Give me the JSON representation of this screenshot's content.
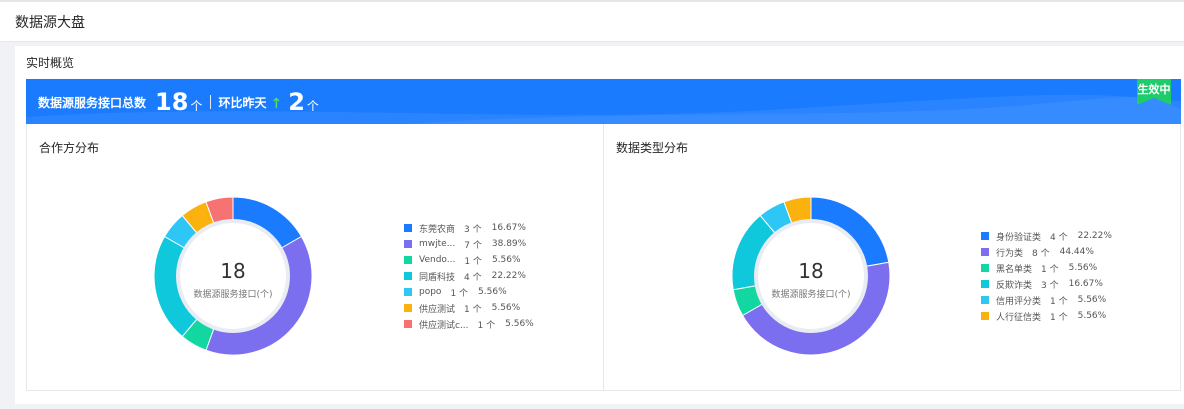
{
  "header": {
    "title": "数据源大盘"
  },
  "overview": {
    "title": "实时概览",
    "total_label": "数据源服务接口总数",
    "total_value": "18",
    "total_unit": "个",
    "compare_label": "环比昨天",
    "compare_arrow": "↑",
    "compare_value": "2",
    "compare_unit": "个",
    "status_badge": "生效中",
    "colors": {
      "banner": "#1a7bff",
      "badge": "#1fcc6b",
      "arrow": "#4cd96a"
    }
  },
  "partner_panel": {
    "title": "合作方分布",
    "center_value": "18",
    "center_caption": "数据源服务接口(个)",
    "items": [
      {
        "label": "东莞农商",
        "count": "3 个",
        "percent": "16.67%",
        "value": 3,
        "color": "#1a7bff"
      },
      {
        "label": "mwjte...",
        "count": "7 个",
        "percent": "38.89%",
        "value": 7,
        "color": "#7b6ff0"
      },
      {
        "label": "Vendo...",
        "count": "1 个",
        "percent": "5.56%",
        "value": 1,
        "color": "#13d7a1"
      },
      {
        "label": "同盾科技",
        "count": "4 个",
        "percent": "22.22%",
        "value": 4,
        "color": "#0fc8dc"
      },
      {
        "label": "popo",
        "count": "1 个",
        "percent": "5.56%",
        "value": 1,
        "color": "#2ec7f5"
      },
      {
        "label": "供应测试",
        "count": "1 个",
        "percent": "5.56%",
        "value": 1,
        "color": "#fbb10e"
      },
      {
        "label": "供应测试c...",
        "count": "1 个",
        "percent": "5.56%",
        "value": 1,
        "color": "#f77272"
      }
    ]
  },
  "type_panel": {
    "title": "数据类型分布",
    "center_value": "18",
    "center_caption": "数据源服务接口(个)",
    "items": [
      {
        "label": "身份验证类",
        "count": "4 个",
        "percent": "22.22%",
        "value": 4,
        "color": "#1a7bff"
      },
      {
        "label": "行为类",
        "count": "8 个",
        "percent": "44.44%",
        "value": 8,
        "color": "#7b6ff0"
      },
      {
        "label": "黑名单类",
        "count": "1 个",
        "percent": "5.56%",
        "value": 1,
        "color": "#13d7a1"
      },
      {
        "label": "反欺诈类",
        "count": "3 个",
        "percent": "16.67%",
        "value": 3,
        "color": "#0fc8dc"
      },
      {
        "label": "信用评分类",
        "count": "1 个",
        "percent": "5.56%",
        "value": 1,
        "color": "#2ec7f5"
      },
      {
        "label": "人行征信类",
        "count": "1 个",
        "percent": "5.56%",
        "value": 1,
        "color": "#fbb10e"
      }
    ]
  }
}
